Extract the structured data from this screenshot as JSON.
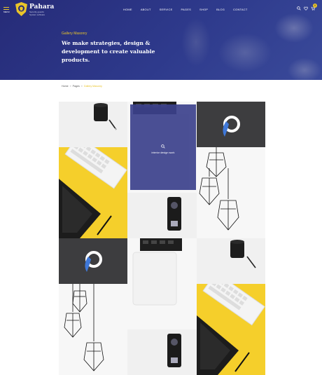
{
  "header": {
    "menu_label": "MENU",
    "logo_name": "Pahara",
    "logo_tagline": "Security guards System software",
    "nav": [
      "HOME",
      "ABOUT",
      "SERVICE",
      "PAGES",
      "SHOP",
      "BLOG",
      "CONTACT"
    ],
    "cart_count": "0",
    "icons": [
      "search-icon",
      "heart-icon",
      "cart-icon"
    ]
  },
  "hero": {
    "subtitle": "Gallery Masonry",
    "title": "We make strategies, design & development to create valuable products."
  },
  "breadcrumb": [
    "Home",
    "Pages",
    "Gallery Masonry"
  ],
  "gallery": {
    "hover_caption": "interior design work",
    "hover_icon": "zoom-icon",
    "items": [
      "coffee-and-pen",
      "keyboard-and-tablet",
      "abstract-logo",
      "pendant-lamps",
      "smartphone",
      "macbook"
    ]
  },
  "colors": {
    "hero_bg": "#262b78",
    "accent": "#e9c42a",
    "overlay": "#3c418c"
  }
}
